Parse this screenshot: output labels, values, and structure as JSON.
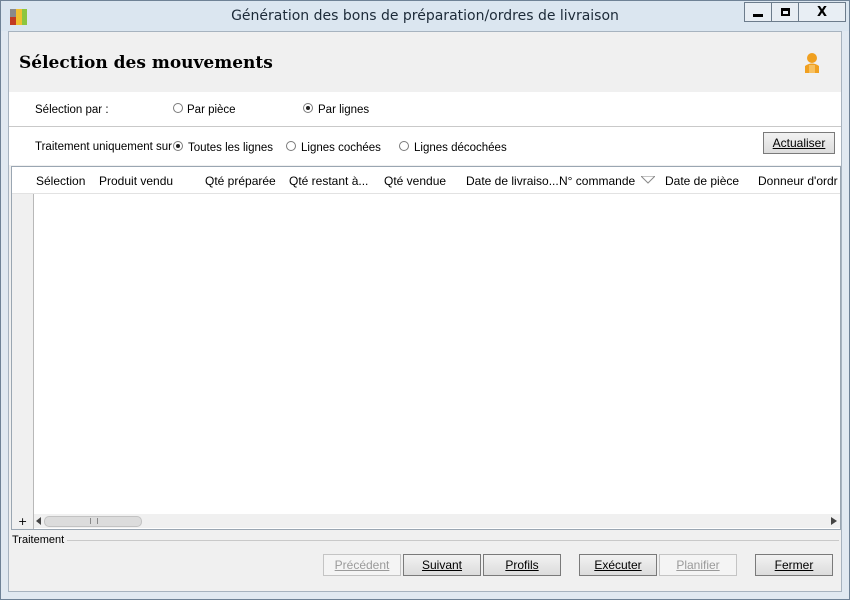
{
  "window": {
    "title": "Génération des bons de préparation/ordres de livraison",
    "controls": {
      "minimize": "▬",
      "maximize": "☐",
      "close": "X"
    }
  },
  "header": {
    "title": "Sélection des mouvements"
  },
  "selection": {
    "label": "Sélection par :",
    "options": [
      {
        "label": "Par pièce",
        "checked": false
      },
      {
        "label": "Par lignes",
        "checked": true
      }
    ]
  },
  "treatment": {
    "label": "Traitement uniquement sur :",
    "options": [
      {
        "label": "Toutes les lignes",
        "checked": true
      },
      {
        "label": "Lignes cochées",
        "checked": false
      },
      {
        "label": "Lignes décochées",
        "checked": false
      }
    ],
    "refresh_button": "Actualiser"
  },
  "grid": {
    "columns": [
      "Sélection",
      "Produit vendu",
      "Qté préparée",
      "Qté restant à...",
      "Qté vendue",
      "Date de livraiso...",
      "N° commande",
      "Date de pièce",
      "Donneur d'ordr"
    ],
    "expand_symbol": "+"
  },
  "status": {
    "label": "Traitement"
  },
  "buttons": {
    "previous": "Précédent",
    "next": "Suivant",
    "profiles": "Profils",
    "execute": "Exécuter",
    "schedule": "Planifier",
    "close": "Fermer"
  },
  "colors": {
    "accent_user": "#f0a020",
    "titlebar": "#dbe6f0"
  }
}
